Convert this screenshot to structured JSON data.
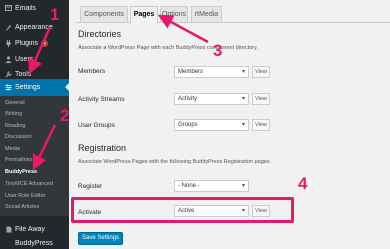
{
  "sidebar": {
    "items": [
      {
        "label": "Emails",
        "icon": "envelope-icon"
      },
      {
        "label": "Appearance",
        "icon": "brush-icon"
      },
      {
        "label": "Plugins",
        "icon": "plug-icon",
        "badge": "1"
      },
      {
        "label": "Users",
        "icon": "user-icon"
      },
      {
        "label": "Tools",
        "icon": "wrench-icon"
      },
      {
        "label": "Settings",
        "icon": "sliders-icon"
      }
    ],
    "submenu": [
      "General",
      "Writing",
      "Reading",
      "Discussion",
      "Media",
      "Permalinks",
      "BuddyPress",
      "TinyMCE Advanced",
      "User Role Editor",
      "Social Articles"
    ],
    "bottom_items": [
      {
        "label": "File Away",
        "icon": "file-icon"
      },
      {
        "label": "BuddyPress",
        "icon": ""
      }
    ]
  },
  "tabs": [
    "Components",
    "Pages",
    "Options",
    "rtMedia"
  ],
  "directories": {
    "title": "Directories",
    "description": "Associate a WordPress Page with each BuddyPress component directory.",
    "rows": [
      {
        "label": "Members",
        "value": "Members",
        "button": "View"
      },
      {
        "label": "Activity Streams",
        "value": "Activity",
        "button": "View"
      },
      {
        "label": "User Groups",
        "value": "Groups",
        "button": "View"
      }
    ]
  },
  "registration": {
    "title": "Registration",
    "description": "Associate WordPress Pages with the following BuddyPress Registration pages.",
    "rows": [
      {
        "label": "Register",
        "value": "- None -",
        "button": ""
      },
      {
        "label": "Activate",
        "value": "Active",
        "button": "View"
      }
    ]
  },
  "save_button": "Save Settings",
  "annotations": [
    "1",
    "2",
    "3",
    "4"
  ],
  "colors": {
    "annotation": "#e8196a",
    "admin_bar": "#23282d",
    "accent": "#0073aa"
  }
}
